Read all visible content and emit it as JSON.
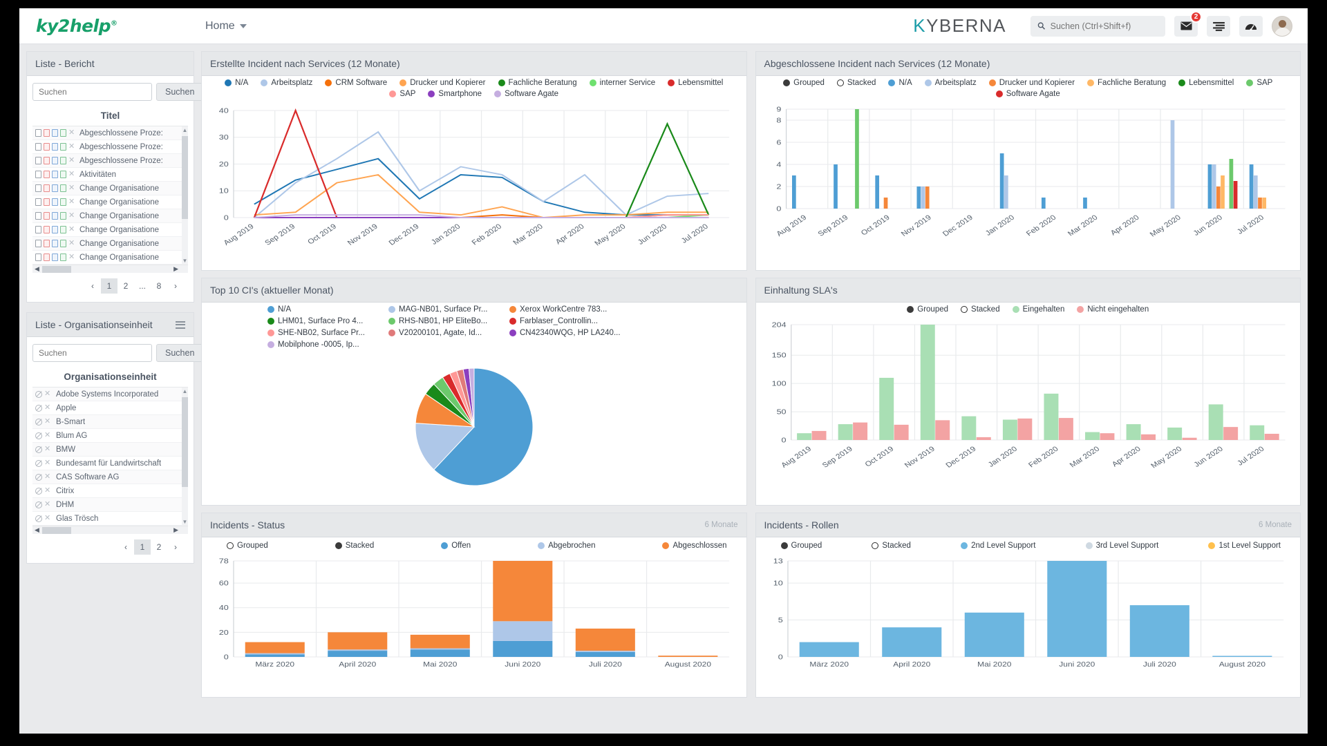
{
  "header": {
    "logo": "ky2help",
    "logo_sup": "®",
    "nav_home": "Home",
    "brand_k": "K",
    "brand_rest": "YBERNA",
    "search_placeholder": "Suchen (Ctrl+Shift+f)",
    "search_value": "",
    "mail_badge": "2"
  },
  "report_panel": {
    "title": "Liste - Bericht",
    "search_placeholder": "Suchen",
    "search_value": "",
    "search_button": "Suchen",
    "column_header": "Titel",
    "rows": [
      {
        "title": "Abgeschlossene Proze:"
      },
      {
        "title": "Abgeschlossene Proze:"
      },
      {
        "title": "Abgeschlossene Proze:"
      },
      {
        "title": "Aktivitäten"
      },
      {
        "title": "Change Organisatione"
      },
      {
        "title": "Change Organisatione"
      },
      {
        "title": "Change Organisatione"
      },
      {
        "title": "Change Organisatione"
      },
      {
        "title": "Change Organisatione"
      },
      {
        "title": "Change Organisatione"
      }
    ],
    "pagination": [
      "‹",
      "1",
      "2",
      "...",
      "8",
      "›"
    ],
    "active_page": "1"
  },
  "org_panel": {
    "title": "Liste - Organisationseinheit",
    "search_placeholder": "Suchen",
    "search_value": "",
    "search_button": "Suchen",
    "column_header": "Organisationseinheit",
    "rows": [
      {
        "name": "Adobe Systems Incorporated"
      },
      {
        "name": "Apple"
      },
      {
        "name": "B-Smart"
      },
      {
        "name": "Blum AG"
      },
      {
        "name": "BMW"
      },
      {
        "name": "Bundesamt für Landwirtschaft"
      },
      {
        "name": "CAS Software AG"
      },
      {
        "name": "Citrix"
      },
      {
        "name": "DHM"
      },
      {
        "name": "Glas Trösch"
      }
    ],
    "pagination": [
      "‹",
      "1",
      "2",
      "›"
    ],
    "active_page": "1"
  },
  "chart_data": [
    {
      "id": "erstellte_incident",
      "title": "Erstellte Incident nach Services (12 Monate)",
      "type": "line",
      "categories": [
        "Aug 2019",
        "Sep 2019",
        "Oct 2019",
        "Nov 2019",
        "Dec 2019",
        "Jan 2020",
        "Feb 2020",
        "Mar 2020",
        "Apr 2020",
        "May 2020",
        "Jun 2020",
        "Jul 2020"
      ],
      "ylim": [
        0,
        40
      ],
      "yticks": [
        0,
        10,
        20,
        30,
        40
      ],
      "grid": true,
      "legend_position": "top",
      "series": [
        {
          "name": "N/A",
          "color": "#1f77b4",
          "values": [
            5,
            14,
            18,
            22,
            7,
            16,
            15,
            6,
            2,
            1,
            1,
            1
          ]
        },
        {
          "name": "Arbeitsplatz",
          "color": "#aec7e8",
          "values": [
            0,
            13,
            22,
            32,
            10,
            19,
            16,
            6,
            16,
            1,
            8,
            9
          ]
        },
        {
          "name": "CRM Software",
          "color": "#f5700a",
          "values": [
            0,
            0,
            0,
            0,
            0,
            0,
            1,
            0,
            0,
            0,
            1,
            1
          ]
        },
        {
          "name": "Drucker und Kopierer",
          "color": "#ffa450",
          "values": [
            1,
            2,
            13,
            16,
            2,
            1,
            4,
            0,
            1,
            1,
            2,
            2
          ]
        },
        {
          "name": "Fachliche Beratung",
          "color": "#1a8a1a",
          "values": [
            0,
            0,
            0,
            0,
            0,
            0,
            0,
            0,
            0,
            0,
            35,
            1
          ]
        },
        {
          "name": "interner Service",
          "color": "#6fe06f",
          "values": [
            0,
            0,
            0,
            0,
            0,
            0,
            0,
            0,
            0,
            0,
            0,
            1
          ]
        },
        {
          "name": "Lebensmittel",
          "color": "#d92b2b",
          "values": [
            0,
            40,
            0,
            0,
            0,
            0,
            0,
            0,
            0,
            0,
            0,
            0
          ]
        },
        {
          "name": "SAP",
          "color": "#ff9896",
          "values": [
            0,
            0,
            0,
            0,
            0,
            0,
            0,
            0,
            0,
            0,
            1,
            1
          ]
        },
        {
          "name": "Smartphone",
          "color": "#8b3fbf",
          "values": [
            0,
            0,
            0,
            0,
            0,
            0,
            0,
            0,
            0,
            0,
            0,
            0
          ]
        },
        {
          "name": "Software Agate",
          "color": "#c5aee0",
          "values": [
            0,
            1,
            1,
            1,
            1,
            0,
            0,
            0,
            0,
            0,
            0,
            0
          ]
        }
      ]
    },
    {
      "id": "abgeschlossene_incident",
      "title": "Abgeschlossene Incident nach Services (12 Monate)",
      "type": "bar",
      "mode": "Grouped",
      "mode_options": [
        "Grouped",
        "Stacked"
      ],
      "categories": [
        "Aug 2019",
        "Sep 2019",
        "Oct 2019",
        "Nov 2019",
        "Dec 2019",
        "Jan 2020",
        "Feb 2020",
        "Mar 2020",
        "Apr 2020",
        "May 2020",
        "Jun 2020",
        "Jul 2020"
      ],
      "ylim": [
        0,
        9
      ],
      "yticks": [
        0,
        2,
        4,
        6,
        8,
        9
      ],
      "grid": true,
      "series": [
        {
          "name": "N/A",
          "color": "#4e9ed4",
          "values": [
            3,
            4,
            3,
            2,
            0,
            5,
            1,
            1,
            0,
            0,
            4,
            4
          ]
        },
        {
          "name": "Arbeitsplatz",
          "color": "#aec7e8",
          "values": [
            0,
            0,
            0,
            2,
            0,
            3,
            0,
            0,
            0,
            8,
            4,
            3
          ]
        },
        {
          "name": "Drucker und Kopierer",
          "color": "#f5873a",
          "values": [
            0,
            0,
            1,
            2,
            0,
            0,
            0,
            0,
            0,
            0,
            2,
            1
          ]
        },
        {
          "name": "Fachliche Beratung",
          "color": "#ffb866",
          "values": [
            0,
            0,
            0,
            0,
            0,
            0,
            0,
            0,
            0,
            0,
            3,
            1
          ]
        },
        {
          "name": "Lebensmittel",
          "color": "#1a8a1a",
          "values": [
            0,
            0,
            0,
            0,
            0,
            0,
            0,
            0,
            0,
            0,
            0,
            0
          ]
        },
        {
          "name": "SAP",
          "color": "#6cc96c",
          "values": [
            0,
            9,
            0,
            0,
            0,
            0,
            0,
            0,
            0,
            0,
            4.5,
            0
          ]
        },
        {
          "name": "Software Agate",
          "color": "#d92b2b",
          "values": [
            0,
            0,
            0,
            0,
            0,
            0,
            0,
            0,
            0,
            0,
            2.5,
            0
          ]
        }
      ]
    },
    {
      "id": "top10_cis",
      "title": "Top 10 CI's (aktueller Monat)",
      "type": "pie",
      "legend_position": "top",
      "slices": [
        {
          "label": "N/A",
          "color": "#4e9ed4",
          "value": 62
        },
        {
          "label": "MAG-NB01, Surface Pr...",
          "color": "#aec7e8",
          "value": 14
        },
        {
          "label": "Xerox WorkCentre 783...",
          "color": "#f5873a",
          "value": 8.5
        },
        {
          "label": "LHM01, Surface Pro 4...",
          "color": "#1a8a1a",
          "value": 3.5
        },
        {
          "label": "RHS-NB01, HP EliteBo...",
          "color": "#6cc96c",
          "value": 3
        },
        {
          "label": "Farblaser_Controllin...",
          "color": "#d92b2b",
          "value": 2.2
        },
        {
          "label": "SHE-NB02, Surface Pr...",
          "color": "#ff9896",
          "value": 2
        },
        {
          "label": "V20200101, Agate, Id...",
          "color": "#e07a7a",
          "value": 1.8
        },
        {
          "label": "CN42340WQG, HP LA240...",
          "color": "#8b3fbf",
          "value": 1.6
        },
        {
          "label": "Mobilphone -0005, Ip...",
          "color": "#c5aee0",
          "value": 1.4
        }
      ]
    },
    {
      "id": "einhaltung_sla",
      "title": "Einhaltung SLA's",
      "type": "bar",
      "mode": "Grouped",
      "mode_options": [
        "Grouped",
        "Stacked"
      ],
      "categories": [
        "Aug 2019",
        "Sep 2019",
        "Oct 2019",
        "Nov 2019",
        "Dec 2019",
        "Jan 2020",
        "Feb 2020",
        "Mar 2020",
        "Apr 2020",
        "May 2020",
        "Jun 2020",
        "Jul 2020"
      ],
      "ylim": [
        0,
        204
      ],
      "yticks": [
        0,
        50,
        100,
        150,
        204
      ],
      "grid": true,
      "series": [
        {
          "name": "Eingehalten",
          "color": "#a9dfb4",
          "values": [
            12,
            28,
            110,
            204,
            42,
            36,
            82,
            14,
            28,
            22,
            63,
            26
          ]
        },
        {
          "name": "Nicht eingehalten",
          "color": "#f3a3a3",
          "values": [
            16,
            31,
            27,
            35,
            5,
            38,
            39,
            12,
            10,
            4,
            23,
            11
          ]
        }
      ]
    },
    {
      "id": "incidents_status",
      "title": "Incidents - Status",
      "header_note": "6 Monate",
      "type": "bar",
      "stacked": true,
      "mode": "Stacked",
      "mode_options": [
        "Grouped",
        "Stacked"
      ],
      "categories": [
        "März 2020",
        "April 2020",
        "Mai 2020",
        "Juni 2020",
        "Juli 2020",
        "August 2020"
      ],
      "ylim": [
        0,
        78
      ],
      "yticks": [
        0,
        20,
        40,
        60,
        78
      ],
      "grid": true,
      "series": [
        {
          "name": "Offen",
          "color": "#4e9ed4",
          "values": [
            2,
            5,
            6,
            13,
            4,
            0
          ]
        },
        {
          "name": "Abgebrochen",
          "color": "#aec7e8",
          "values": [
            1,
            1,
            1,
            16,
            1,
            0
          ]
        },
        {
          "name": "Abgeschlossen",
          "color": "#f5873a",
          "values": [
            9,
            14,
            11,
            49,
            18,
            1
          ]
        }
      ]
    },
    {
      "id": "incidents_rollen",
      "title": "Incidents - Rollen",
      "header_note": "6 Monate",
      "type": "bar",
      "mode": "Grouped",
      "mode_options": [
        "Grouped",
        "Stacked"
      ],
      "categories": [
        "März 2020",
        "April 2020",
        "Mai 2020",
        "Juni 2020",
        "Juli 2020",
        "August 2020"
      ],
      "ylim": [
        0,
        13
      ],
      "yticks": [
        0,
        5,
        10,
        13
      ],
      "grid": true,
      "series": [
        {
          "name": "2nd Level Support",
          "color": "#6cb6e0",
          "values": [
            2,
            4,
            6,
            13,
            7,
            0.1
          ]
        },
        {
          "name": "3rd Level Support",
          "color": "#cfd9e2",
          "values": [
            0,
            0,
            0,
            0,
            0,
            0
          ]
        },
        {
          "name": "1st Level Support",
          "color": "#ffc04d",
          "values": [
            0,
            0,
            0,
            0,
            0,
            0
          ]
        }
      ]
    }
  ]
}
